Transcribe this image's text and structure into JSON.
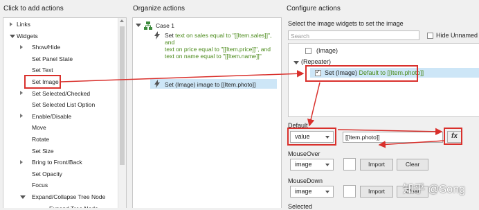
{
  "left": {
    "title": "Click to add actions",
    "items": [
      {
        "label": "Links",
        "arrow": "right",
        "indent": 0
      },
      {
        "label": "Widgets",
        "arrow": "down",
        "indent": 0
      },
      {
        "label": "Show/Hide",
        "arrow": "right",
        "indent": 1
      },
      {
        "label": "Set Panel State",
        "arrow": "",
        "indent": 1
      },
      {
        "label": "Set Text",
        "arrow": "",
        "indent": 1
      },
      {
        "label": "Set Image",
        "arrow": "",
        "indent": 1
      },
      {
        "label": "Set Selected/Checked",
        "arrow": "right",
        "indent": 1
      },
      {
        "label": "Set Selected List Option",
        "arrow": "",
        "indent": 1
      },
      {
        "label": "Enable/Disable",
        "arrow": "right",
        "indent": 1
      },
      {
        "label": "Move",
        "arrow": "",
        "indent": 1
      },
      {
        "label": "Rotate",
        "arrow": "",
        "indent": 1
      },
      {
        "label": "Set Size",
        "arrow": "",
        "indent": 1
      },
      {
        "label": "Bring to Front/Back",
        "arrow": "right",
        "indent": 1
      },
      {
        "label": "Set Opacity",
        "arrow": "",
        "indent": 1
      },
      {
        "label": "Focus",
        "arrow": "",
        "indent": 1
      },
      {
        "label": "Expand/Collapse Tree Node",
        "arrow": "down",
        "indent": 1
      },
      {
        "label": "Expand Tree Node",
        "arrow": "",
        "indent": 2
      }
    ]
  },
  "middle": {
    "title": "Organize actions",
    "case_label": "Case 1",
    "action1": {
      "line1_prefix": "Set ",
      "line1_green": "text on sales equal to \"[[Item.sales]]\",",
      "line2_green": "and",
      "line3_green": "text on price equal to \"[[Item.price]]\", and",
      "line4_green": "text on name equal to \"[[Item.name]]\""
    },
    "action2": {
      "prefix": "Set ",
      "target": "(Image) image to [[Item.photo]]"
    }
  },
  "right": {
    "title": "Configure actions",
    "subtitle": "Select the image widgets to set the image",
    "search_placeholder": "Search",
    "hide_unnamed_label": "Hide Unnamed",
    "widget_image_label": "(Image)",
    "repeater_label": "(Repeater)",
    "selected_prefix": "Set (Image) ",
    "selected_green": "Default to [[Item.photo]]",
    "default_label": "Default",
    "default_select": "value",
    "default_value": "[[Item.photo]]",
    "fx_label": "fx",
    "mouseover_label": "MouseOver",
    "mouseover_select": "image",
    "mousedown_label": "MouseDown",
    "mousedown_select": "image",
    "import_label": "Import",
    "clear_label": "Clear",
    "bottom_label": "Selected"
  },
  "watermark": "知乎 @Song",
  "colors": {
    "annotation": "#d9302c",
    "green_text": "#4a8a1a",
    "selection": "#cde6f7"
  }
}
